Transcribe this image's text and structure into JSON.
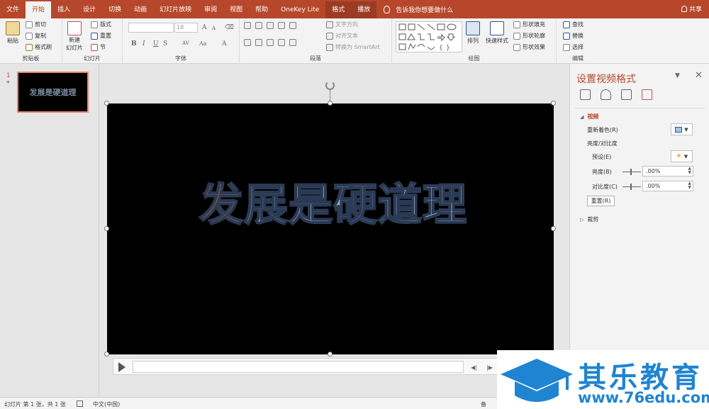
{
  "tabs": [
    "文件",
    "开始",
    "插入",
    "设计",
    "切换",
    "动画",
    "幻灯片放映",
    "审阅",
    "视图",
    "帮助",
    "OneKey Lite",
    "格式",
    "播放"
  ],
  "tellme": "告诉我你想要做什么",
  "share": "共享",
  "ribbon": {
    "clipboard": {
      "paste": "粘贴",
      "cut": "剪切",
      "copy": "复制",
      "format_painter": "格式刷",
      "label": "剪贴板"
    },
    "slides": {
      "new_slide": "新建\n幻灯片",
      "layout": "版式",
      "reset": "重置",
      "section": "节",
      "label": "幻灯片"
    },
    "font": {
      "size": "18",
      "bold": "B",
      "italic": "I",
      "underline": "U",
      "strike": "S",
      "spacing": "AV",
      "case": "Aa",
      "color": "A",
      "grow": "A",
      "shrink": "A",
      "label": "字体"
    },
    "paragraph": {
      "text_direction": "文字方向",
      "align_text": "对齐文本",
      "smartart": "转换为 SmartArt",
      "label": "段落"
    },
    "drawing": {
      "arrange": "排列",
      "quick_styles": "快速样式",
      "shape_fill": "形状填充",
      "shape_outline": "形状轮廓",
      "shape_effects": "形状效果",
      "label": "绘图"
    },
    "editing": {
      "find": "查找",
      "replace": "替换",
      "select": "选择",
      "label": "编辑"
    }
  },
  "thumbnails": [
    {
      "number": "1",
      "star": "*",
      "text": "发展是硬道理"
    }
  ],
  "slide": {
    "text": "发展是硬道理"
  },
  "pane": {
    "title": "设置视频格式",
    "video_section": "视频",
    "recolor": "重新着色(R)",
    "brightness_contrast": "亮度/对比度",
    "presets": "预设(E)",
    "brightness_label": "亮度(B)",
    "brightness_value": ".00%",
    "contrast_label": "对比度(C)",
    "contrast_value": ".00%",
    "reset": "重置(R)",
    "crop_section": "裁剪"
  },
  "status": {
    "slide_info": "幻灯片 第 1 张，共 1 张",
    "language": "中文(中国)",
    "notes": "备"
  },
  "watermark": {
    "title": "其乐教育",
    "url": "www.76edu.com"
  },
  "colors": {
    "accent": "#b7472a",
    "watermark": "#1f84d2"
  }
}
